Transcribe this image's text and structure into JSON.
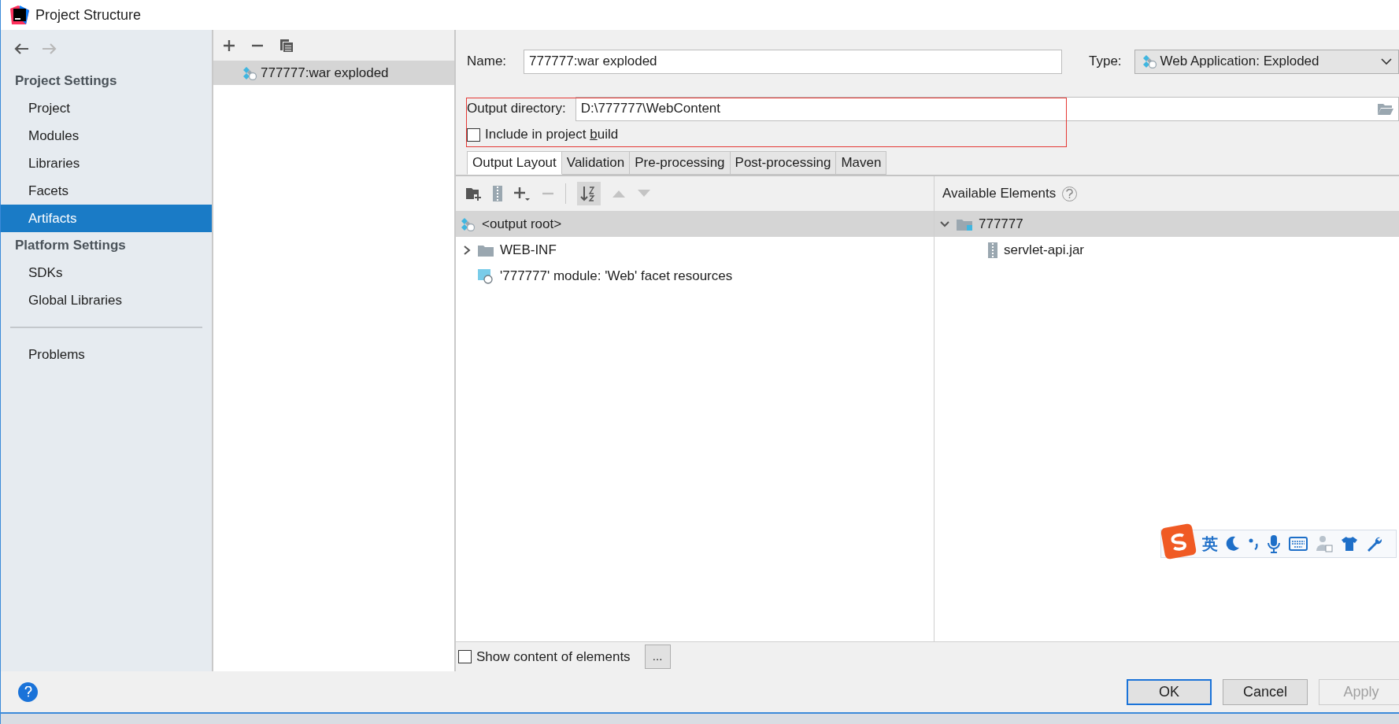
{
  "window": {
    "title": "Project Structure"
  },
  "nav": {
    "back_disabled": false,
    "forward_disabled": true
  },
  "sidebar": {
    "sections": [
      {
        "kind": "header",
        "label": "Project Settings"
      },
      {
        "kind": "item",
        "label": "Project",
        "selected": false
      },
      {
        "kind": "item",
        "label": "Modules",
        "selected": false
      },
      {
        "kind": "item",
        "label": "Libraries",
        "selected": false
      },
      {
        "kind": "item",
        "label": "Facets",
        "selected": false
      },
      {
        "kind": "item",
        "label": "Artifacts",
        "selected": true
      },
      {
        "kind": "header",
        "label": "Platform Settings"
      },
      {
        "kind": "item",
        "label": "SDKs",
        "selected": false
      },
      {
        "kind": "item",
        "label": "Global Libraries",
        "selected": false
      },
      {
        "kind": "divider"
      },
      {
        "kind": "item",
        "label": "Problems",
        "selected": false
      }
    ]
  },
  "artifacts": [
    {
      "label": "777777:war exploded",
      "selected": true
    }
  ],
  "form": {
    "name_label": "Name:",
    "name_value": "777777:war exploded",
    "type_label": "Type:",
    "type_value": "Web Application: Exploded",
    "output_label": "Output directory:",
    "output_value": "D:\\777777\\WebContent",
    "highlighted": true,
    "include_label": "Include in project ",
    "include_mnemonic": "b",
    "include_rest": "uild",
    "include_checked": false
  },
  "tabs": [
    {
      "label": "Output Layout",
      "selected": true
    },
    {
      "label": "Validation",
      "selected": false
    },
    {
      "label": "Pre-processing",
      "selected": false
    },
    {
      "label": "Post-processing",
      "selected": false
    },
    {
      "label": "Maven",
      "selected": false
    }
  ],
  "layout_tree": [
    {
      "kind": "root",
      "label": "<output root>",
      "selected": true
    },
    {
      "kind": "folder",
      "label": "WEB-INF",
      "selected": false,
      "expanded": false,
      "has_children": true
    },
    {
      "kind": "module",
      "label": "'777777' module: 'Web' facet resources",
      "selected": false,
      "has_children": false
    }
  ],
  "available": {
    "title": "Available Elements",
    "items": [
      {
        "kind": "module-folder",
        "label": "777777",
        "selected": true,
        "expanded": true,
        "children": [
          {
            "kind": "jar",
            "label": "servlet-api.jar",
            "selected": false
          }
        ]
      }
    ]
  },
  "show_content": {
    "label": "Show content of elements",
    "checked": false,
    "more": "..."
  },
  "ime": {
    "label": "英"
  },
  "buttons": [
    {
      "label": "OK",
      "default": true,
      "disabled": false
    },
    {
      "label": "Cancel",
      "default": false,
      "disabled": false
    },
    {
      "label": "Apply",
      "default": false,
      "disabled": true
    }
  ]
}
